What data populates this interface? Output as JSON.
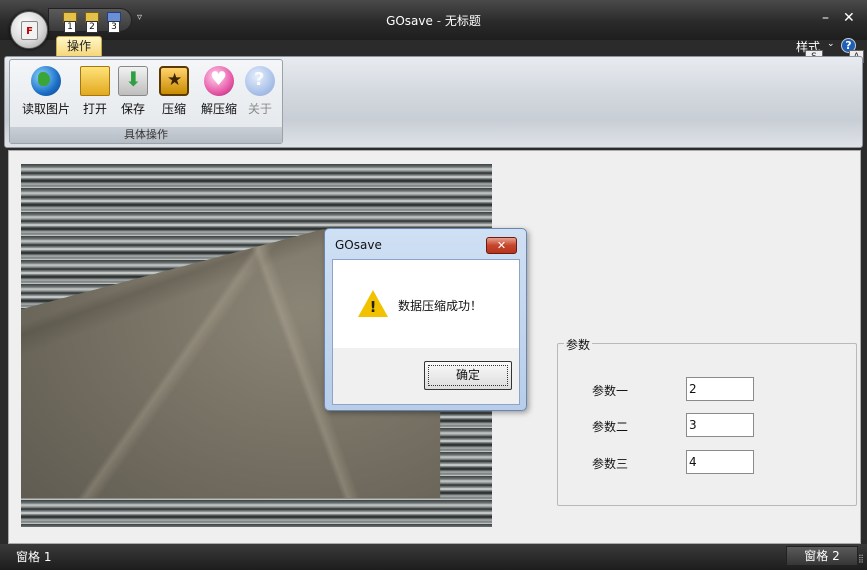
{
  "window": {
    "app_name": "GOsave",
    "separator": "-",
    "doc_title": "无标题",
    "minimize": "–",
    "close": "✕"
  },
  "app_button": {
    "icon": "app-menu-icon",
    "glyph": "F"
  },
  "quick_access": {
    "items": [
      {
        "icon": "folder-icon",
        "key": "1"
      },
      {
        "icon": "folder-icon",
        "key": "2"
      },
      {
        "icon": "save-icon",
        "key": "3"
      }
    ],
    "more": "▿"
  },
  "tabs": [
    {
      "label": "操作"
    }
  ],
  "style_menu": {
    "label": "样式",
    "caret": "⌄",
    "key": "S"
  },
  "help": {
    "glyph": "?",
    "key": "A"
  },
  "ribbon": {
    "group_label": "具体操作",
    "buttons": [
      {
        "label": "读取图片",
        "icon": "globe-icon",
        "enabled": true
      },
      {
        "label": "打开",
        "icon": "folder-open-icon",
        "enabled": true
      },
      {
        "label": "保存",
        "icon": "save-download-icon",
        "enabled": true
      },
      {
        "label": "压缩",
        "icon": "compress-star-icon",
        "enabled": true
      },
      {
        "label": "解压缩",
        "icon": "decompress-heart-icon",
        "enabled": true
      },
      {
        "label": "关于",
        "icon": "help-about-icon",
        "enabled": false
      }
    ]
  },
  "params": {
    "title": "参数",
    "rows": [
      {
        "label": "参数一",
        "value": "2"
      },
      {
        "label": "参数二",
        "value": "3"
      },
      {
        "label": "参数三",
        "value": "4"
      }
    ]
  },
  "dialog": {
    "title": "GOsave",
    "close": "✕",
    "message": "数据压缩成功！",
    "ok_label": "确定",
    "icon": "warning-icon",
    "icon_glyph": "!"
  },
  "statusbar": {
    "pane1": "窗格 1",
    "pane2": "窗格 2",
    "grip": "⣿"
  }
}
